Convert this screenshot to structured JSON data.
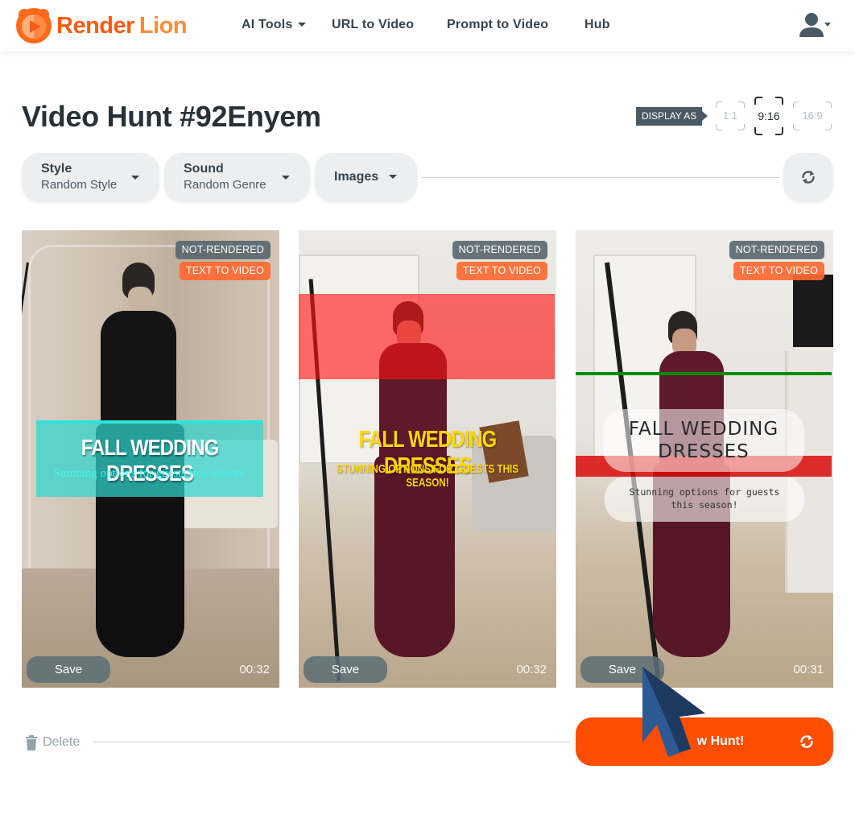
{
  "brand": {
    "name_part1": "Render",
    "name_part2": "Lion",
    "primary_color": "#ff5a14",
    "secondary_color": "#ff8a3a"
  },
  "nav": {
    "items": [
      {
        "label": "AI Tools",
        "has_dropdown": true
      },
      {
        "label": "URL to Video",
        "has_dropdown": false
      },
      {
        "label": "Prompt to Video",
        "has_dropdown": false
      },
      {
        "label": "Hub",
        "has_dropdown": false
      }
    ],
    "user_icon": "user-icon"
  },
  "header": {
    "title": "Video Hunt #92Enyem",
    "display_as_label": "DISPLAY AS",
    "ratios": [
      {
        "label": "1:1",
        "active": false
      },
      {
        "label": "9:16",
        "active": true
      },
      {
        "label": "16:9",
        "active": false
      }
    ]
  },
  "filters": {
    "style": {
      "title": "Style",
      "value": "Random Style"
    },
    "sound": {
      "title": "Sound",
      "value": "Random Genre"
    },
    "images": {
      "title": "Images"
    },
    "refresh_icon": "refresh-icon"
  },
  "cards": [
    {
      "status_badge": "NOT-RENDERED",
      "type_badge": "TEXT TO VIDEO",
      "headline": "FALL WEDDING DRESSES",
      "subline": "Stunning options for guests this season!",
      "save_label": "Save",
      "duration": "00:32",
      "theme_color": "#2fd6cf"
    },
    {
      "status_badge": "NOT-RENDERED",
      "type_badge": "TEXT TO VIDEO",
      "headline": "FALL WEDDING DRESSES",
      "subline": "STUNNING OPTIONS FOR GUESTS THIS SEASON!",
      "save_label": "Save",
      "duration": "00:32",
      "theme_color": "#f5d000"
    },
    {
      "status_badge": "NOT-RENDERED",
      "type_badge": "TEXT TO VIDEO",
      "headline_line1": "FALL WEDDING",
      "headline_line2": "DRESSES",
      "subline_line1": "Stunning options for guests",
      "subline_line2": "this season!",
      "save_label": "Save",
      "duration": "00:31",
      "theme_color": "#e01010"
    }
  ],
  "footer": {
    "delete_label": "Delete",
    "new_hunt_label_visible": "w Hunt!",
    "new_hunt_color": "#ff4e00"
  }
}
